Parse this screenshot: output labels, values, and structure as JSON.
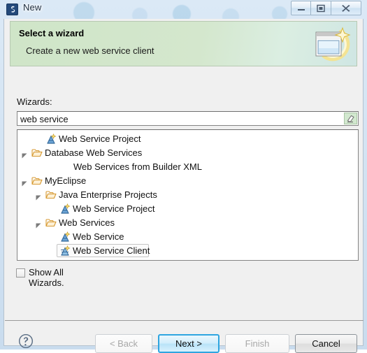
{
  "window": {
    "title": "New",
    "icon": "myeclipse-app-icon",
    "controls": {
      "minimize": "minimize-icon",
      "maximize": "restore-icon",
      "close": "close-icon"
    }
  },
  "banner": {
    "title": "Select a wizard",
    "subtitle": "Create a new web service client",
    "icon": "wizard-sparkle-icon",
    "background_color": "#d4e7cd"
  },
  "form": {
    "wizards_label": "Wizards:",
    "filter": {
      "value": "web service",
      "placeholder": "type filter text",
      "clear_icon": "clear-filter-icon"
    },
    "show_all": {
      "label": "Show All Wizards.",
      "checked": false
    }
  },
  "tree": {
    "selected": "Web Service Client",
    "items": [
      {
        "label": "Web Service Project",
        "depth": 1,
        "icon": "wizard-icon",
        "twisty": "none",
        "selected": false
      },
      {
        "label": "Database Web Services",
        "depth": 0,
        "icon": "open-folder-icon",
        "twisty": "expanded",
        "selected": false
      },
      {
        "label": "Web Services from Builder XML",
        "depth": 2,
        "icon": "none",
        "twisty": "none",
        "selected": false
      },
      {
        "label": "MyEclipse",
        "depth": 0,
        "icon": "open-folder-icon",
        "twisty": "expanded",
        "selected": false
      },
      {
        "label": "Java Enterprise Projects",
        "depth": 1,
        "icon": "open-folder-icon",
        "twisty": "expanded",
        "selected": false
      },
      {
        "label": "Web Service Project",
        "depth": 2,
        "icon": "wizard-icon",
        "twisty": "none",
        "selected": false
      },
      {
        "label": "Web Services",
        "depth": 1,
        "icon": "open-folder-icon",
        "twisty": "expanded",
        "selected": false
      },
      {
        "label": "Web Service",
        "depth": 2,
        "icon": "wizard-icon",
        "twisty": "none",
        "selected": false
      },
      {
        "label": "Web Service Client",
        "depth": 2,
        "icon": "wizard-client-icon",
        "twisty": "none",
        "selected": true
      }
    ]
  },
  "buttons": {
    "help": "help-icon",
    "back": {
      "label": "< Back",
      "enabled": false,
      "default": false
    },
    "next": {
      "label": "Next >",
      "enabled": true,
      "default": true
    },
    "finish": {
      "label": "Finish",
      "enabled": false,
      "default": false
    },
    "cancel": {
      "label": "Cancel",
      "enabled": true,
      "default": false
    }
  },
  "colors": {
    "banner_green": "#d4e7cd",
    "default_button_border": "#2ea5e0",
    "folder_orange": "#e8a33d",
    "dialog_face": "#f0f0f0"
  }
}
